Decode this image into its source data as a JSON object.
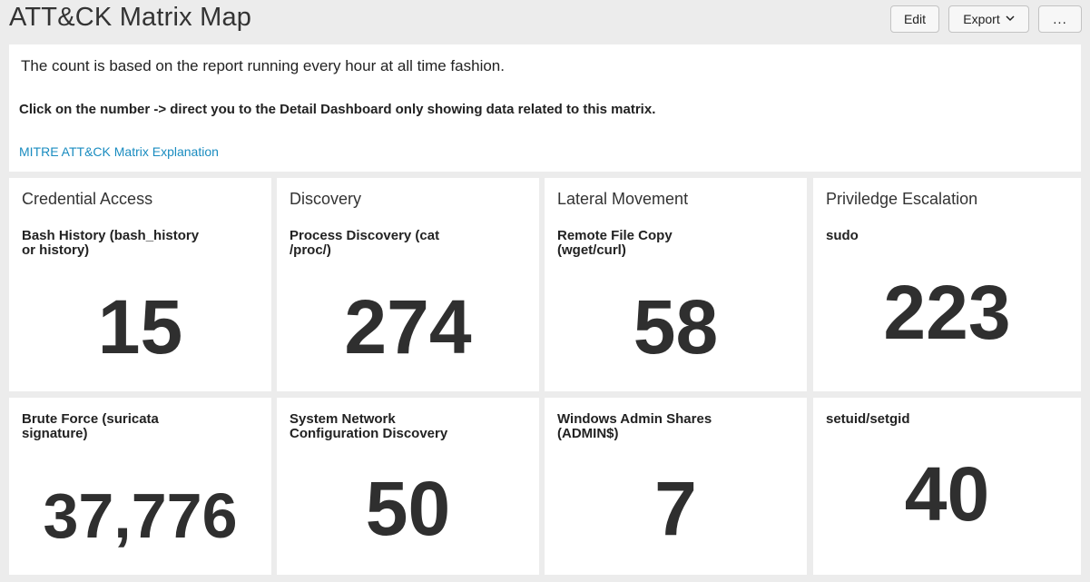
{
  "header": {
    "title": "ATT&CK Matrix Map",
    "edit_label": "Edit",
    "export_label": "Export",
    "more_label": "..."
  },
  "info": {
    "line1": "The count is based on the report running every hour at all time fashion.",
    "line2": "Click on the number -> direct you to the Detail Dashboard only showing data related to this matrix.",
    "link": "MITRE ATT&CK Matrix Explanation"
  },
  "columns": [
    {
      "title": "Credential Access",
      "panels": [
        {
          "label": "Bash History (bash_history\nor history)",
          "value": "15"
        },
        {
          "label": "Brute Force (suricata\nsignature)",
          "value": "37,776"
        }
      ]
    },
    {
      "title": "Discovery",
      "panels": [
        {
          "label": "Process Discovery (cat\n/proc/)",
          "value": "274"
        },
        {
          "label": "System Network\nConfiguration Discovery",
          "value": "50"
        }
      ]
    },
    {
      "title": "Lateral Movement",
      "panels": [
        {
          "label": "Remote File Copy\n(wget/curl)",
          "value": "58"
        },
        {
          "label": "Windows Admin Shares\n(ADMIN$)",
          "value": "7"
        }
      ]
    },
    {
      "title": "Priviledge Escalation",
      "panels": [
        {
          "label": "sudo",
          "value": "223"
        },
        {
          "label": "setuid/setgid",
          "value": "40"
        }
      ]
    }
  ]
}
